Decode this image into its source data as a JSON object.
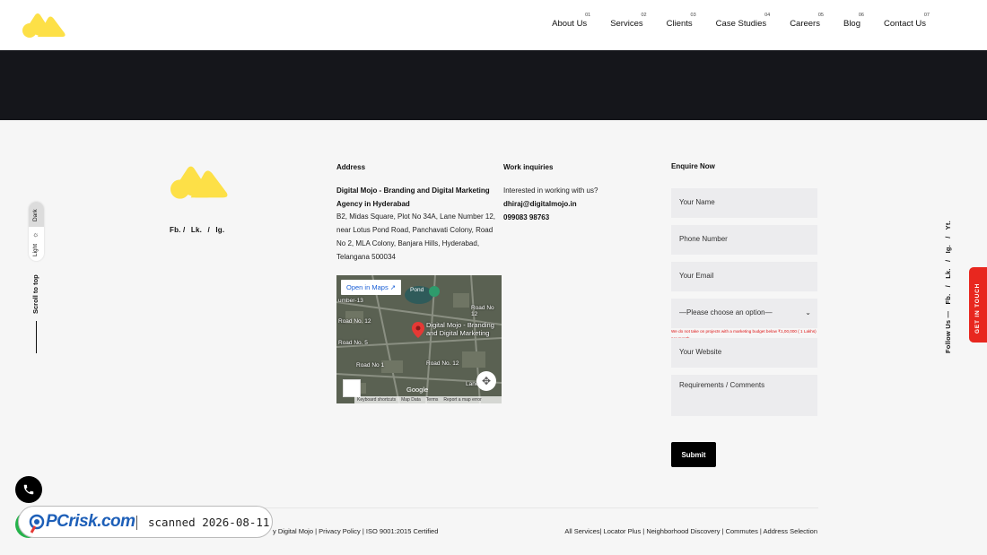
{
  "brand": {
    "primary": "#fde047",
    "dark": "#15161b",
    "red": "#e8271f"
  },
  "nav": [
    {
      "num": "01",
      "label": "About Us"
    },
    {
      "num": "02",
      "label": "Services"
    },
    {
      "num": "03",
      "label": "Clients"
    },
    {
      "num": "04",
      "label": "Case Studies"
    },
    {
      "num": "05",
      "label": "Careers"
    },
    {
      "num": "06",
      "label": "Blog"
    },
    {
      "num": "07",
      "label": "Contact Us"
    }
  ],
  "footer": {
    "social": [
      "Fb. /",
      "Lk.",
      "/",
      "Ig."
    ],
    "address": {
      "title": "Address",
      "name": "Digital Mojo - Branding and Digital Marketing Agency in Hyderabad",
      "text": "B2, Midas Square, Plot No 34A, Lane Number 12, near Lotus Pond Road, Panchavati Colony, Road No 2, MLA Colony, Banjara Hills, Hyderabad, Telangana 500034"
    },
    "map": {
      "open_label": "Open in Maps",
      "pond_label": "Pond",
      "place_label": "Digital Mojo - Branding and Digital Marketing",
      "roads": [
        "umber-13",
        "Road No. 12",
        "Road No. 5",
        "Road No 12",
        "Road No. 12",
        "Lane No. 6",
        "Road No 1"
      ],
      "google_label": "Google",
      "footer_items": [
        "Keyboard shortcuts",
        "Map Data",
        "Terms",
        "Report a map error"
      ]
    },
    "work": {
      "title": "Work inquiries",
      "intro": "Interested in working with us?",
      "email": "dhiraj@digitalmojo.in",
      "phone": "099083 98763"
    },
    "form": {
      "title": "Enquire Now",
      "name_placeholder": "Your Name",
      "phone_placeholder": "Phone Number",
      "email_placeholder": "Your Email",
      "select_value": "—Please choose an option—",
      "notice": "We do not take on projects with a marketing budget below ₹1,00,000 ( 1 Lakhs) per month.",
      "website_placeholder": "Your Website",
      "comments_placeholder": "Requirements / Comments",
      "submit_label": "Submit"
    }
  },
  "side_left": {
    "dark_label": "Dark",
    "light_label": "Light",
    "scroll_label": "Scroll to top"
  },
  "side_right": {
    "follow": [
      "Follow Us —",
      "Fb.",
      "/",
      "Lk.",
      "/",
      "Ig.",
      "/",
      "Yt."
    ],
    "get_in_touch": "GET IN TOUCH"
  },
  "bottom": {
    "left": "y Digital Mojo | Privacy Policy | ISO 9001:2015 Certified",
    "right": "All Services| Locator Plus | Neighborhood Discovery | Commutes | Address Selection"
  },
  "watermark": {
    "brand": "PCrisk.com",
    "scanned": "scanned 2026-08-11"
  }
}
